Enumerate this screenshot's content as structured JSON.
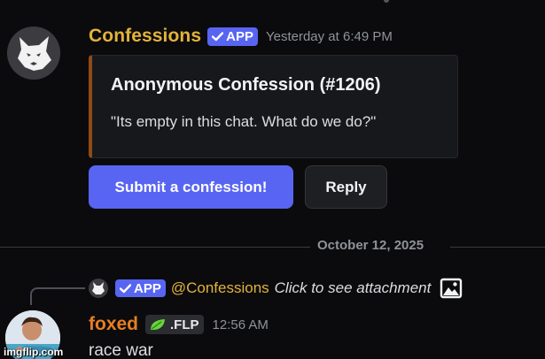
{
  "message1": {
    "username": "Confessions",
    "app_badge": "APP",
    "timestamp": "Yesterday at 6:49 PM",
    "embed": {
      "title": "Anonymous Confession (#1206)",
      "description": "\"Its empty in this chat. What do we do?\"",
      "accent_color": "#8f4a16"
    },
    "buttons": {
      "submit_label": "Submit a confession!",
      "reply_label": "Reply"
    }
  },
  "divider": {
    "date": "October 12, 2025"
  },
  "reply_preview": {
    "app_badge": "APP",
    "mention": "@Confessions",
    "content": "Click to see attachment",
    "icon": "image-icon"
  },
  "message2": {
    "username": "foxed",
    "role_tag": ".FLP",
    "timestamp": "12:56 AM",
    "text": "race war"
  },
  "watermark": "imgflip.com",
  "colors": {
    "background": "#0b0b0d",
    "blurple": "#5865f2",
    "gold_name": "#e2b33b",
    "orange_name": "#e67e22"
  }
}
